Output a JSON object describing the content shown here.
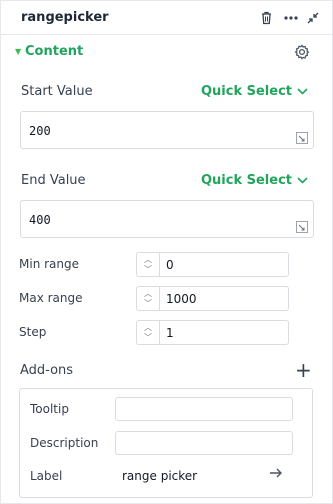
{
  "header": {
    "title": "rangepicker",
    "icons": [
      "trash-icon",
      "more-icon",
      "collapse-icon"
    ]
  },
  "section": {
    "title": "Content",
    "icon": "gear-icon"
  },
  "start": {
    "label": "Start Value",
    "quick_select": "Quick Select",
    "value": "200"
  },
  "end": {
    "label": "End Value",
    "quick_select": "Quick Select",
    "value": "400"
  },
  "rows": {
    "min": {
      "label": "Min range",
      "value": "0"
    },
    "max": {
      "label": "Max range",
      "value": "1000"
    },
    "step": {
      "label": "Step",
      "value": "1"
    }
  },
  "addons": {
    "title": "Add-ons",
    "tooltip_label": "Tooltip",
    "tooltip_value": "",
    "description_label": "Description",
    "description_value": "",
    "label_label": "Label",
    "label_value": "range picker"
  },
  "colors": {
    "accent": "#22a45d",
    "border": "#d9dce1"
  }
}
